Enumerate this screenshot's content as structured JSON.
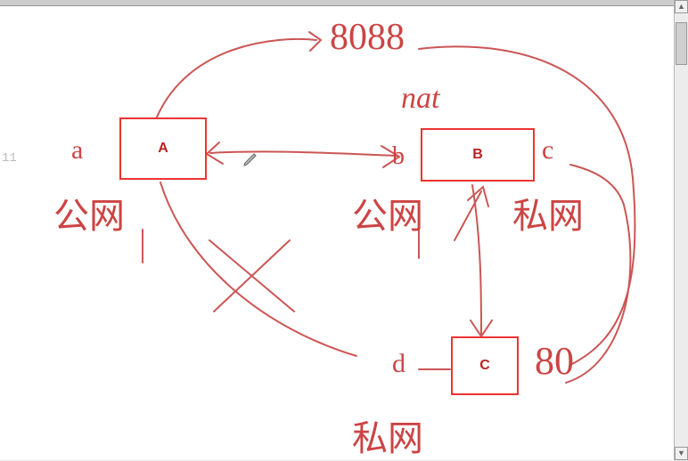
{
  "editor": {
    "line_number": "11"
  },
  "boxes": {
    "a": {
      "label": "A"
    },
    "b": {
      "label": "B"
    },
    "c": {
      "label": "C"
    }
  },
  "annotations": {
    "port_top": "8088",
    "nat": "nat",
    "a_side": "a",
    "b_side": "b",
    "c_side": "c",
    "d_side": "d",
    "port_bottom": "80",
    "public_net_left": "公网",
    "public_net_mid": "公网",
    "private_net_right": "私网",
    "private_net_bottom": "私网"
  },
  "scrollbar": {
    "thumb_top_pct": 2,
    "thumb_height_pct": 10
  }
}
